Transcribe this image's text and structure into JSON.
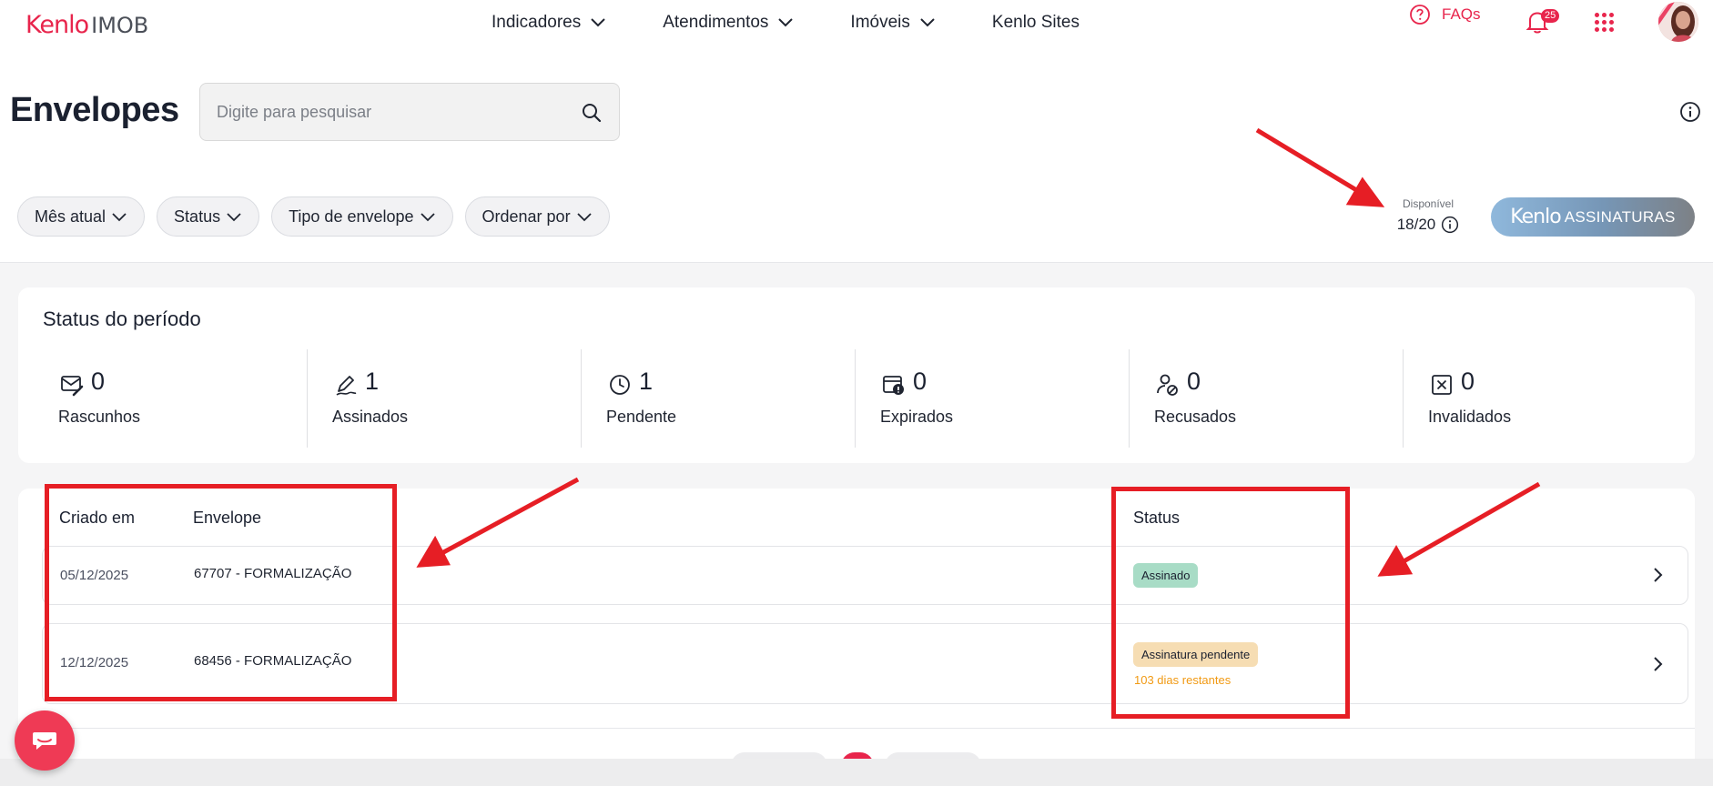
{
  "logo": {
    "kenlo": "Kenlo",
    "product": "IMOB"
  },
  "nav": {
    "items": [
      {
        "label": "Indicadores",
        "has_dropdown": true
      },
      {
        "label": "Atendimentos",
        "has_dropdown": true
      },
      {
        "label": "Imóveis",
        "has_dropdown": true
      },
      {
        "label": "Kenlo Sites",
        "has_dropdown": false
      }
    ],
    "faq_label": "FAQs",
    "notifications_count": "25"
  },
  "page": {
    "title": "Envelopes",
    "search_placeholder": "Digite para pesquisar"
  },
  "filters": [
    "Mês atual",
    "Status",
    "Tipo de envelope",
    "Ordenar por"
  ],
  "availability": {
    "label": "Disponível",
    "value": "18/20"
  },
  "assinaturas_button": {
    "brand": "Kenlo",
    "label": "ASSINATURAS"
  },
  "status_period": {
    "title": "Status do período",
    "stats": [
      {
        "icon": "draft-envelope-icon",
        "value": "0",
        "label": "Rascunhos"
      },
      {
        "icon": "signature-pen-icon",
        "value": "1",
        "label": "Assinados"
      },
      {
        "icon": "clock-icon",
        "value": "1",
        "label": "Pendente"
      },
      {
        "icon": "expired-calendar-icon",
        "value": "0",
        "label": "Expirados"
      },
      {
        "icon": "refused-user-icon",
        "value": "0",
        "label": "Recusados"
      },
      {
        "icon": "invalid-x-icon",
        "value": "0",
        "label": "Invalidados"
      }
    ]
  },
  "table": {
    "headers": {
      "created": "Criado em",
      "envelope": "Envelope",
      "status": "Status"
    },
    "rows": [
      {
        "created": "05/12/2025",
        "envelope": "67707 - FORMALIZAÇÃO",
        "status": "Assinado",
        "remaining": ""
      },
      {
        "created": "12/12/2025",
        "envelope": "68456 - FORMALIZAÇÃO",
        "status": "Assinatura pendente",
        "remaining": "103 dias restantes"
      }
    ]
  },
  "colors": {
    "brand": "#e8254c",
    "annotation": "#e61e25",
    "signed_badge": "#a8dcc6",
    "pending_badge": "#f6ddb3",
    "remaining_text": "#f19a14"
  }
}
